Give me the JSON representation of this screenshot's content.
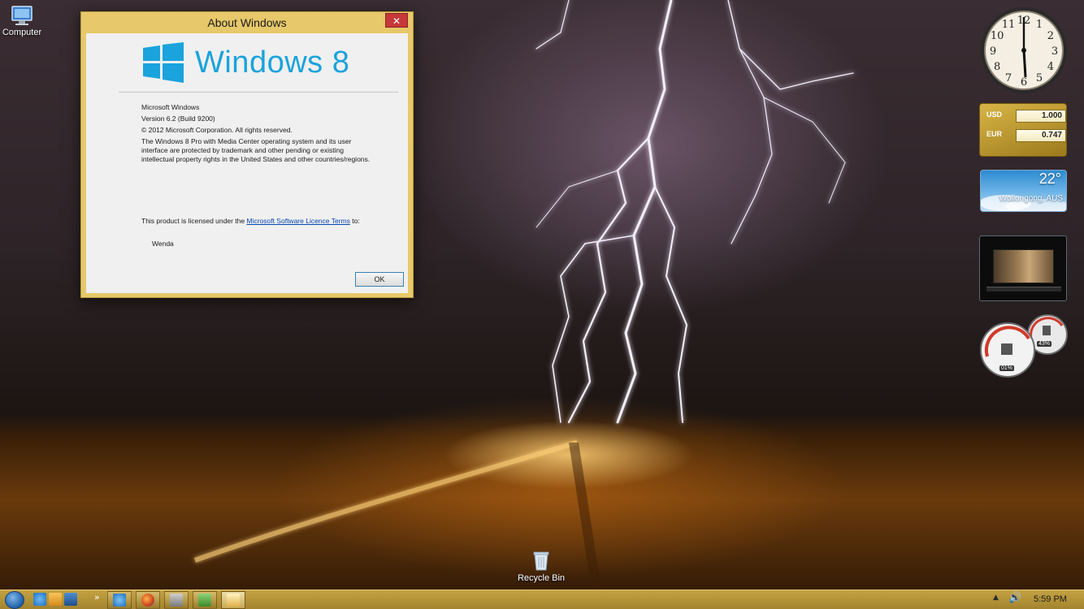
{
  "desktop": {
    "computer_label": "Computer",
    "recycle_bin_label": "Recycle Bin"
  },
  "about_window": {
    "title": "About Windows",
    "close_glyph": "✕",
    "logo_text": "Windows 8",
    "product_name": "Microsoft Windows",
    "version": "Version 6.2 (Build 9200)",
    "copyright": "© 2012 Microsoft Corporation. All rights reserved.",
    "description": "The Windows 8 Pro with Media Center operating system and its user interface are protected by trademark and other pending or existing intellectual property rights in the United States and other countries/regions.",
    "license_prefix": "This product is licensed under the ",
    "license_link": "Microsoft Software Licence Terms",
    "license_suffix": " to:",
    "licensed_user": "Wenda",
    "ok_label": "OK"
  },
  "gadgets": {
    "clock": {
      "numbers": [
        "12",
        "1",
        "2",
        "3",
        "4",
        "5",
        "6",
        "7",
        "8",
        "9",
        "10",
        "11"
      ],
      "time": "5:59"
    },
    "currency": {
      "rows": [
        {
          "code": "USD",
          "value": "1.000"
        },
        {
          "code": "EUR",
          "value": "0.747"
        }
      ]
    },
    "weather": {
      "temperature": "22°",
      "location": "Wollongong, AUS"
    },
    "cpu_meter": {
      "cpu_percent": "01%",
      "memory_percent": "43%"
    }
  },
  "taskbar": {
    "overflow_glyph": "»",
    "tray_arrow": "▲",
    "volume_glyph": "🔊",
    "time": "5:59 PM"
  },
  "colors": {
    "title_bar": "#e7c86a",
    "logo_blue": "#1aa3dc",
    "taskbar": "#b4932f",
    "close_button": "#c7383a"
  }
}
